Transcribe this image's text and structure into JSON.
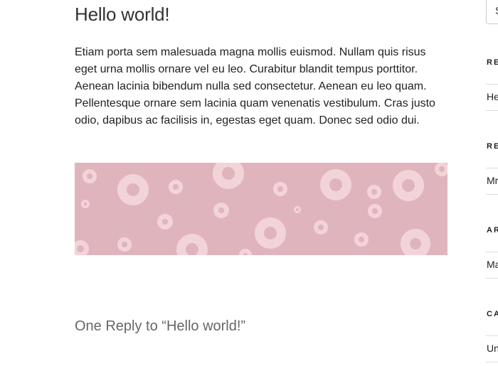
{
  "post": {
    "title": "Hello world!",
    "body": "Etiam porta sem malesuada magna mollis euismod. Nullam quis risus eget urna mollis ornare vel eu leo. Curabitur blandit tempus porttitor. Aenean lacinia bibendum nulla sed consectetur. Aenean eu leo quam. Pellentesque ornare sem lacinia quam venenatis vestibulum. Cras justo odio, dapibus ac facilisis in, egestas eget quam. Donec sed odio dui."
  },
  "pattern": {
    "background_color": "#e0b4bd",
    "ring_color": "#f3d3da"
  },
  "comments": {
    "title": "One Reply to “Hello world!”"
  },
  "sidebar": {
    "search_placeholder": "S",
    "widgets": [
      {
        "title": "RE",
        "item": "He"
      },
      {
        "title": "RE",
        "item": "Mr"
      },
      {
        "title": "AR",
        "item": "Ma"
      },
      {
        "title": "CA",
        "item": "Un"
      }
    ]
  }
}
